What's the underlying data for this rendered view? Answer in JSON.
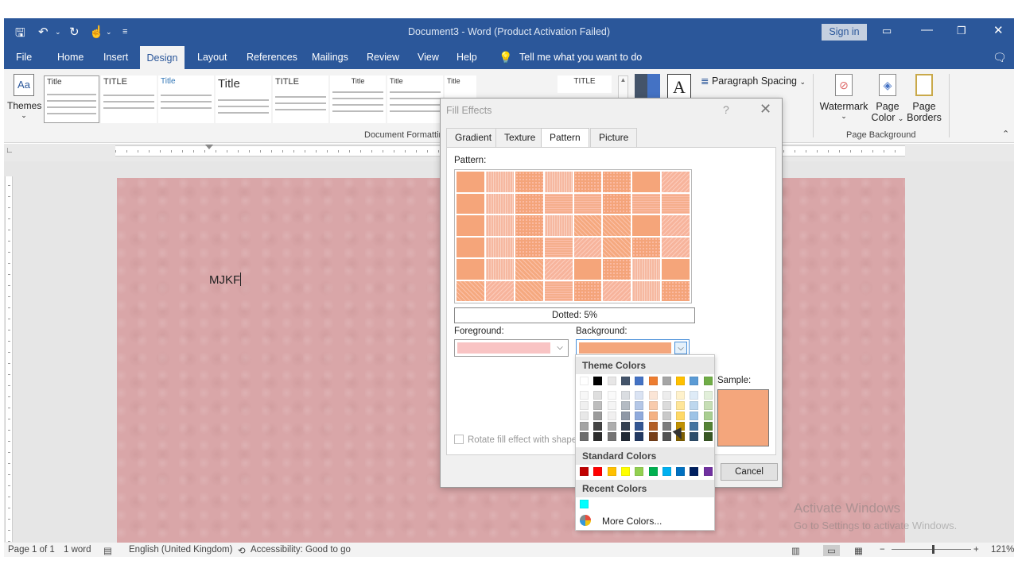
{
  "window": {
    "title": "Document3  -  Word (Product Activation Failed)",
    "sign_in": "Sign in"
  },
  "tabs": [
    {
      "label": "File"
    },
    {
      "label": "Home"
    },
    {
      "label": "Insert"
    },
    {
      "label": "Design"
    },
    {
      "label": "Layout"
    },
    {
      "label": "References"
    },
    {
      "label": "Mailings"
    },
    {
      "label": "Review"
    },
    {
      "label": "View"
    },
    {
      "label": "Help"
    },
    {
      "label": "Tell me what you want to do"
    }
  ],
  "ribbon": {
    "themes_label": "Themes",
    "gallery": [
      "Title",
      "TITLE",
      "Title",
      "Title",
      "TITLE",
      "Title",
      "Title",
      "Title",
      "Title",
      "TITLE"
    ],
    "document_formatting": "Document Formatting",
    "paragraph_spacing": "Paragraph Spacing",
    "watermark": "Watermark",
    "page_color_1": "Page",
    "page_color_2": "Color",
    "page_borders_1": "Page",
    "page_borders_2": "Borders",
    "page_background": "Page Background"
  },
  "document": {
    "text": "MJKF"
  },
  "status": {
    "page": "Page 1 of 1",
    "words": "1 word",
    "language": "English (United Kingdom)",
    "accessibility": "Accessibility: Good to go",
    "zoom": "121%"
  },
  "activate": {
    "line1": "Activate Windows",
    "line2": "Go to Settings to activate Windows."
  },
  "dialog": {
    "title": "Fill Effects",
    "help": "?",
    "tabs": [
      "Gradient",
      "Texture",
      "Pattern",
      "Picture"
    ],
    "pattern_label": "Pattern:",
    "pattern_name": "Dotted: 5%",
    "foreground_label": "Foreground:",
    "background_label": "Background:",
    "foreground_color": "#f9c4c4",
    "background_color": "#f4a67c",
    "rotate_label": "Rotate fill effect with shape",
    "sample_label": "Sample:",
    "cancel": "Cancel"
  },
  "color_menu": {
    "theme_colors": "Theme Colors",
    "standard_colors": "Standard Colors",
    "recent_colors": "Recent Colors",
    "more_colors": "More Colors...",
    "theme_row": [
      "#ffffff",
      "#000000",
      "#e7e6e6",
      "#44546a",
      "#4472c4",
      "#ed7d31",
      "#a5a5a5",
      "#ffc000",
      "#5b9bd5",
      "#70ad47"
    ],
    "standard_row": [
      "#c00000",
      "#ff0000",
      "#ffc000",
      "#ffff00",
      "#92d050",
      "#00b050",
      "#00b0f0",
      "#0070c0",
      "#002060",
      "#7030a0"
    ],
    "recent_row": [
      "#00ffff"
    ]
  }
}
